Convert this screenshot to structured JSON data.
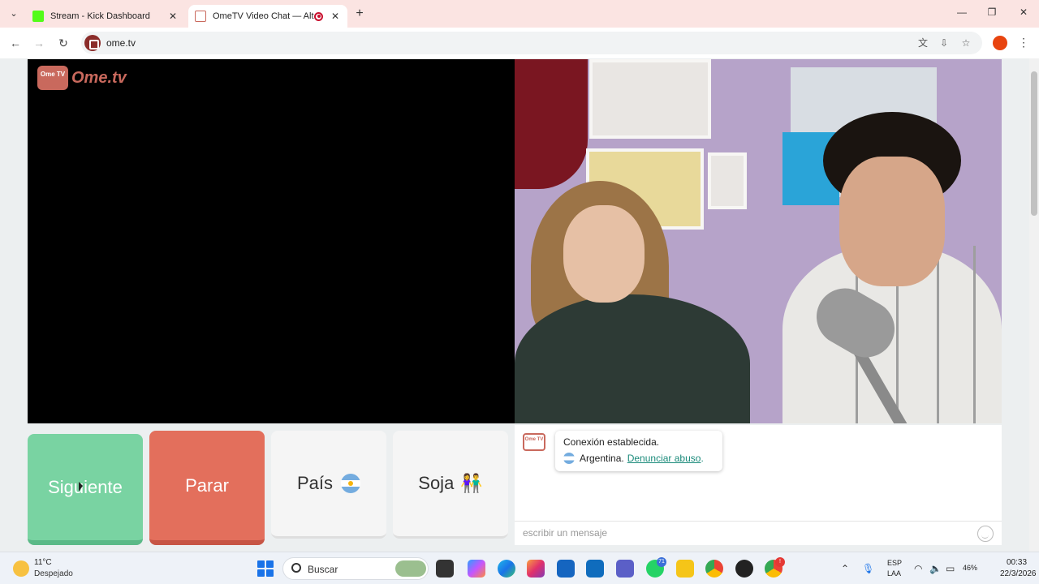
{
  "browser": {
    "tabs": [
      {
        "title": "Stream - Kick Dashboard",
        "favicon_color": "#53fc18"
      },
      {
        "title": "OmeTV Video Chat — Alte",
        "favicon_color": "#c9695d"
      }
    ],
    "url": "ome.tv"
  },
  "page": {
    "logo_tv": "Ome TV",
    "logo_text": "Ome.tv",
    "buttons": {
      "next": "Siguiente",
      "stop": "Parar",
      "country": "País",
      "gender": "Soja",
      "gender_emoji": "👫"
    },
    "chat": {
      "logo": "Ome TV",
      "connected_message": "Conexión establecida.",
      "country": "Argentina",
      "separator": " .",
      "report_link": "Denunciar abuso",
      "report_suffix": ".",
      "input_placeholder": "escribir un mensaje"
    }
  },
  "taskbar": {
    "weather_temp": "11°C",
    "weather_desc": "Despejado",
    "search_label": "Buscar",
    "badge_teams": "71",
    "badge_chrome": "!",
    "lang_top": "ESP",
    "lang_bottom": "LAA",
    "battery": "46%",
    "time": "00:33",
    "date": "22/3/2026"
  }
}
